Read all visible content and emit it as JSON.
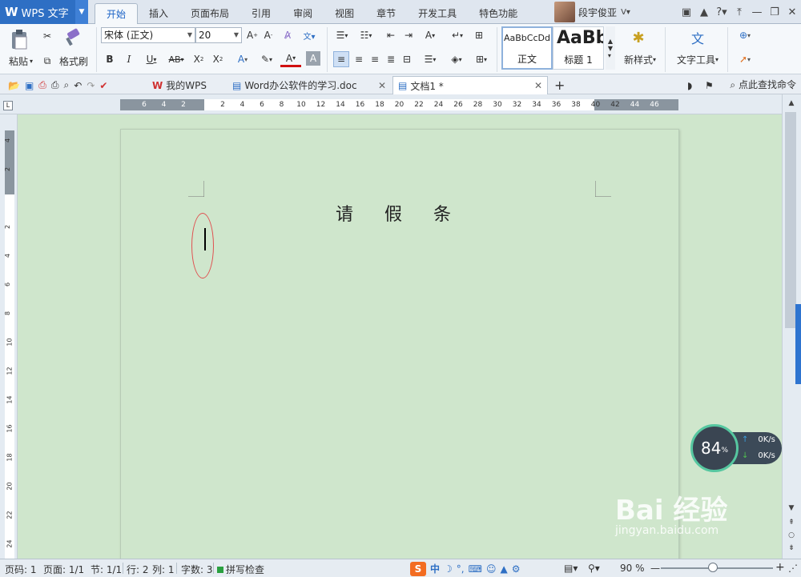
{
  "app": {
    "name": "WPS 文字",
    "logo": "W"
  },
  "menu_tabs": [
    "开始",
    "插入",
    "页面布局",
    "引用",
    "审阅",
    "视图",
    "章节",
    "开发工具",
    "特色功能"
  ],
  "user": {
    "name": "段宇俊亚"
  },
  "ribbon": {
    "paste": "粘贴",
    "format_painter": "格式刷",
    "font_name": "宋体 (正文)",
    "font_size": "20",
    "styles": [
      {
        "sample": "AaBbCcDd",
        "label": "正文"
      },
      {
        "sample": "AaBb",
        "label": "标题 1"
      }
    ],
    "new_style": "新样式",
    "text_tools": "文字工具"
  },
  "doc_tabs": [
    {
      "label": "我的WPS"
    },
    {
      "label": "Word办公软件的学习.doc"
    },
    {
      "label": "文档1 *"
    }
  ],
  "search_command": "点此查找命令",
  "ruler_ticks": [
    "6",
    "4",
    "2",
    "",
    "2",
    "4",
    "6",
    "8",
    "10",
    "12",
    "14",
    "16",
    "18",
    "20",
    "22",
    "24",
    "26",
    "28",
    "30",
    "32",
    "34",
    "36",
    "38",
    "40",
    "42",
    "44",
    "46"
  ],
  "vruler_ticks": [
    "4",
    "2",
    "",
    "2",
    "4",
    "6",
    "8",
    "10",
    "12",
    "14",
    "16",
    "18",
    "20",
    "22",
    "24"
  ],
  "document": {
    "title": "请 假 条"
  },
  "network": {
    "percent": "84",
    "unit": "%",
    "up": "0K/s",
    "down": "0K/s"
  },
  "watermark": {
    "brand": "Bai 经验",
    "url": "jingyan.baidu.com"
  },
  "status": {
    "page_num": "页码: 1",
    "pages": "页面: 1/1",
    "section": "节: 1/1",
    "row": "行: 2",
    "col": "列: 1",
    "words": "字数: 3",
    "spell": "拼写检查",
    "zoom": "90 %"
  }
}
